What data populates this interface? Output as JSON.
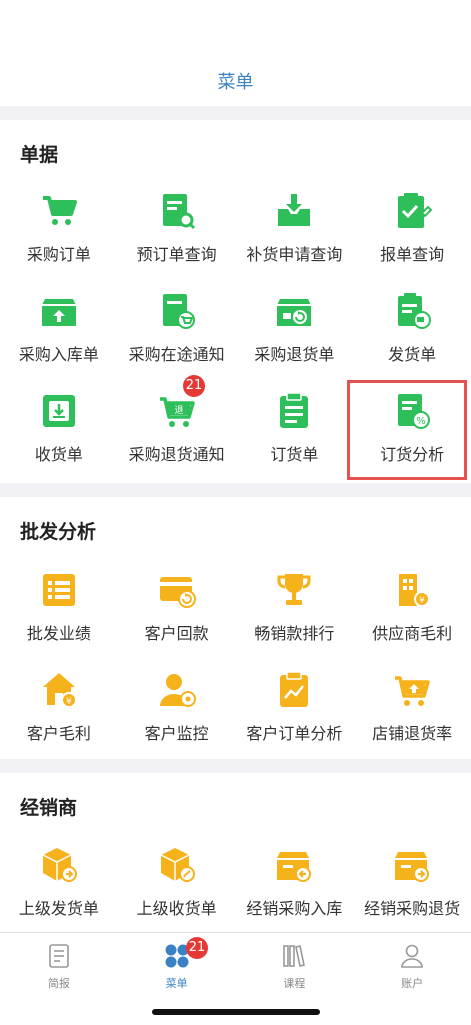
{
  "header": {
    "title": "菜单"
  },
  "sections": [
    {
      "title": "单据",
      "items": [
        {
          "label": "采购订单",
          "icon": "cart-icon"
        },
        {
          "label": "预订单查询",
          "icon": "doc-search-icon"
        },
        {
          "label": "补货申请查询",
          "icon": "tray-download-icon"
        },
        {
          "label": "报单查询",
          "icon": "doc-edit-icon"
        },
        {
          "label": "采购入库单",
          "icon": "box-in-icon"
        },
        {
          "label": "采购在途通知",
          "icon": "doc-cart-icon"
        },
        {
          "label": "采购退货单",
          "icon": "box-return-icon"
        },
        {
          "label": "发货单",
          "icon": "doc-truck-icon"
        },
        {
          "label": "收货单",
          "icon": "receive-icon"
        },
        {
          "label": "采购退货通知",
          "icon": "cart-return-icon",
          "badge": "21"
        },
        {
          "label": "订货单",
          "icon": "clipboard-icon"
        },
        {
          "label": "订货分析",
          "icon": "doc-percent-icon"
        }
      ]
    },
    {
      "title": "批发分析",
      "items": [
        {
          "label": "批发业绩",
          "icon": "list-icon"
        },
        {
          "label": "客户回款",
          "icon": "card-return-icon"
        },
        {
          "label": "畅销款排行",
          "icon": "trophy-icon"
        },
        {
          "label": "供应商毛利",
          "icon": "building-icon"
        },
        {
          "label": "客户毛利",
          "icon": "house-money-icon"
        },
        {
          "label": "客户监控",
          "icon": "user-watch-icon"
        },
        {
          "label": "客户订单分析",
          "icon": "clipboard-chart-icon"
        },
        {
          "label": "店铺退货率",
          "icon": "cart-up-icon"
        }
      ]
    },
    {
      "title": "经销商",
      "items": [
        {
          "label": "上级发货单",
          "icon": "box-send-icon"
        },
        {
          "label": "上级收货单",
          "icon": "box-receive-icon"
        },
        {
          "label": "经销采购入库",
          "icon": "box-in2-icon"
        },
        {
          "label": "经销采购退货",
          "icon": "box-out-icon"
        }
      ]
    }
  ],
  "tabbar": [
    {
      "label": "简报",
      "icon": "report-icon"
    },
    {
      "label": "菜单",
      "icon": "menu-grid-icon",
      "badge": "21",
      "active": true
    },
    {
      "label": "课程",
      "icon": "books-icon"
    },
    {
      "label": "账户",
      "icon": "person-icon"
    }
  ],
  "colors": {
    "green": "#2fbf5a",
    "orange": "#f5b21a",
    "blue": "#3b82c4",
    "badge": "#e53935"
  }
}
